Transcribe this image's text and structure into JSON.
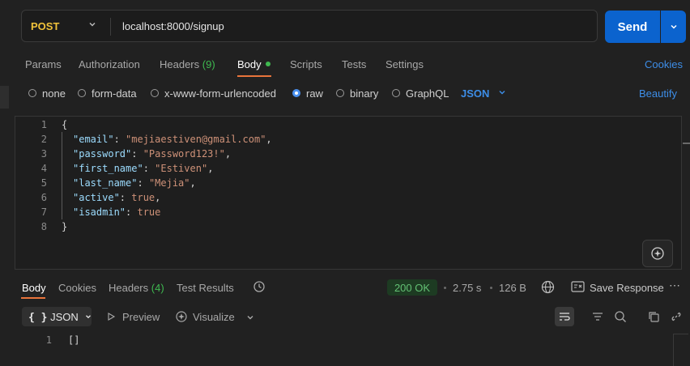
{
  "request": {
    "method": "POST",
    "url": "localhost:8000/signup",
    "send_label": "Send"
  },
  "request_tabs": {
    "params": "Params",
    "authorization": "Authorization",
    "headers": "Headers",
    "headers_count": "(9)",
    "body": "Body",
    "scripts": "Scripts",
    "tests": "Tests",
    "settings": "Settings",
    "cookies": "Cookies"
  },
  "body_types": {
    "none": "none",
    "form_data": "form-data",
    "urlencoded": "x-www-form-urlencoded",
    "raw": "raw",
    "binary": "binary",
    "graphql": "GraphQL",
    "selected_format": "JSON",
    "beautify": "Beautify"
  },
  "editor": {
    "line_numbers": [
      "1",
      "2",
      "3",
      "4",
      "5",
      "6",
      "7",
      "8"
    ],
    "open_brace": "{",
    "close_brace": "}",
    "fields": {
      "email_key": "\"email\"",
      "email_val": "\"mejiaestiven@gmail.com\"",
      "password_key": "\"password\"",
      "password_val": "\"Password123!\"",
      "first_name_key": "\"first_name\"",
      "first_name_val": "\"Estiven\"",
      "last_name_key": "\"last_name\"",
      "last_name_val": "\"Mejia\"",
      "active_key": "\"active\"",
      "active_val": "true",
      "isadmin_key": "\"isadmin\"",
      "isadmin_val": "true"
    }
  },
  "response": {
    "tabs": {
      "body": "Body",
      "cookies": "Cookies",
      "headers": "Headers",
      "headers_count": "(4)",
      "test_results": "Test Results"
    },
    "status": "200 OK",
    "time": "2.75 s",
    "size": "126 B",
    "save_response": "Save Response",
    "view_mode": "JSON",
    "preview": "Preview",
    "visualize": "Visualize",
    "line_number": "1",
    "content": "[]"
  },
  "colors": {
    "accent_blue": "#0b63ce",
    "method_yellow": "#f0c23a",
    "success_green": "#63c174",
    "tab_underline": "#e8743b"
  }
}
